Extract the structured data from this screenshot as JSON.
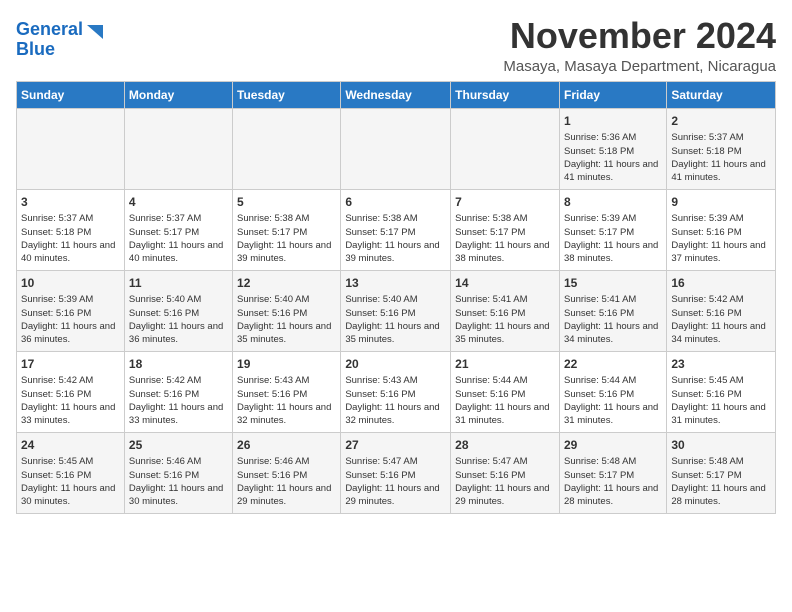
{
  "header": {
    "logo_line1": "General",
    "logo_line2": "Blue",
    "month_title": "November 2024",
    "location": "Masaya, Masaya Department, Nicaragua"
  },
  "days_of_week": [
    "Sunday",
    "Monday",
    "Tuesday",
    "Wednesday",
    "Thursday",
    "Friday",
    "Saturday"
  ],
  "weeks": [
    [
      {
        "day": "",
        "info": ""
      },
      {
        "day": "",
        "info": ""
      },
      {
        "day": "",
        "info": ""
      },
      {
        "day": "",
        "info": ""
      },
      {
        "day": "",
        "info": ""
      },
      {
        "day": "1",
        "info": "Sunrise: 5:36 AM\nSunset: 5:18 PM\nDaylight: 11 hours and 41 minutes."
      },
      {
        "day": "2",
        "info": "Sunrise: 5:37 AM\nSunset: 5:18 PM\nDaylight: 11 hours and 41 minutes."
      }
    ],
    [
      {
        "day": "3",
        "info": "Sunrise: 5:37 AM\nSunset: 5:18 PM\nDaylight: 11 hours and 40 minutes."
      },
      {
        "day": "4",
        "info": "Sunrise: 5:37 AM\nSunset: 5:17 PM\nDaylight: 11 hours and 40 minutes."
      },
      {
        "day": "5",
        "info": "Sunrise: 5:38 AM\nSunset: 5:17 PM\nDaylight: 11 hours and 39 minutes."
      },
      {
        "day": "6",
        "info": "Sunrise: 5:38 AM\nSunset: 5:17 PM\nDaylight: 11 hours and 39 minutes."
      },
      {
        "day": "7",
        "info": "Sunrise: 5:38 AM\nSunset: 5:17 PM\nDaylight: 11 hours and 38 minutes."
      },
      {
        "day": "8",
        "info": "Sunrise: 5:39 AM\nSunset: 5:17 PM\nDaylight: 11 hours and 38 minutes."
      },
      {
        "day": "9",
        "info": "Sunrise: 5:39 AM\nSunset: 5:16 PM\nDaylight: 11 hours and 37 minutes."
      }
    ],
    [
      {
        "day": "10",
        "info": "Sunrise: 5:39 AM\nSunset: 5:16 PM\nDaylight: 11 hours and 36 minutes."
      },
      {
        "day": "11",
        "info": "Sunrise: 5:40 AM\nSunset: 5:16 PM\nDaylight: 11 hours and 36 minutes."
      },
      {
        "day": "12",
        "info": "Sunrise: 5:40 AM\nSunset: 5:16 PM\nDaylight: 11 hours and 35 minutes."
      },
      {
        "day": "13",
        "info": "Sunrise: 5:40 AM\nSunset: 5:16 PM\nDaylight: 11 hours and 35 minutes."
      },
      {
        "day": "14",
        "info": "Sunrise: 5:41 AM\nSunset: 5:16 PM\nDaylight: 11 hours and 35 minutes."
      },
      {
        "day": "15",
        "info": "Sunrise: 5:41 AM\nSunset: 5:16 PM\nDaylight: 11 hours and 34 minutes."
      },
      {
        "day": "16",
        "info": "Sunrise: 5:42 AM\nSunset: 5:16 PM\nDaylight: 11 hours and 34 minutes."
      }
    ],
    [
      {
        "day": "17",
        "info": "Sunrise: 5:42 AM\nSunset: 5:16 PM\nDaylight: 11 hours and 33 minutes."
      },
      {
        "day": "18",
        "info": "Sunrise: 5:42 AM\nSunset: 5:16 PM\nDaylight: 11 hours and 33 minutes."
      },
      {
        "day": "19",
        "info": "Sunrise: 5:43 AM\nSunset: 5:16 PM\nDaylight: 11 hours and 32 minutes."
      },
      {
        "day": "20",
        "info": "Sunrise: 5:43 AM\nSunset: 5:16 PM\nDaylight: 11 hours and 32 minutes."
      },
      {
        "day": "21",
        "info": "Sunrise: 5:44 AM\nSunset: 5:16 PM\nDaylight: 11 hours and 31 minutes."
      },
      {
        "day": "22",
        "info": "Sunrise: 5:44 AM\nSunset: 5:16 PM\nDaylight: 11 hours and 31 minutes."
      },
      {
        "day": "23",
        "info": "Sunrise: 5:45 AM\nSunset: 5:16 PM\nDaylight: 11 hours and 31 minutes."
      }
    ],
    [
      {
        "day": "24",
        "info": "Sunrise: 5:45 AM\nSunset: 5:16 PM\nDaylight: 11 hours and 30 minutes."
      },
      {
        "day": "25",
        "info": "Sunrise: 5:46 AM\nSunset: 5:16 PM\nDaylight: 11 hours and 30 minutes."
      },
      {
        "day": "26",
        "info": "Sunrise: 5:46 AM\nSunset: 5:16 PM\nDaylight: 11 hours and 29 minutes."
      },
      {
        "day": "27",
        "info": "Sunrise: 5:47 AM\nSunset: 5:16 PM\nDaylight: 11 hours and 29 minutes."
      },
      {
        "day": "28",
        "info": "Sunrise: 5:47 AM\nSunset: 5:16 PM\nDaylight: 11 hours and 29 minutes."
      },
      {
        "day": "29",
        "info": "Sunrise: 5:48 AM\nSunset: 5:17 PM\nDaylight: 11 hours and 28 minutes."
      },
      {
        "day": "30",
        "info": "Sunrise: 5:48 AM\nSunset: 5:17 PM\nDaylight: 11 hours and 28 minutes."
      }
    ]
  ]
}
